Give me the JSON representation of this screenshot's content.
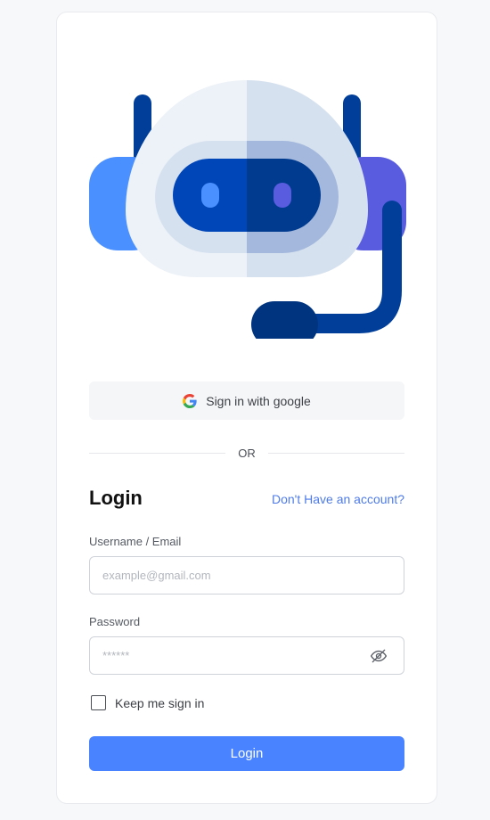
{
  "colors": {
    "accent": "#4a83ff",
    "link": "#4e7be8",
    "page_background": "#f7f8fa",
    "card_background": "#ffffff"
  },
  "illustration": {
    "icon": "robot-headset-icon"
  },
  "google_signin": {
    "icon": "google-icon",
    "label": "Sign in with google"
  },
  "divider": {
    "text": "OR"
  },
  "form": {
    "title": "Login",
    "signup_link": "Don't Have an account?",
    "username": {
      "label": "Username / Email",
      "placeholder": "example@gmail.com",
      "value": ""
    },
    "password": {
      "label": "Password",
      "placeholder": "******",
      "value": "",
      "toggle_icon": "eye-off-icon"
    },
    "remember": {
      "label": "Keep me sign in",
      "checked": false
    },
    "submit_label": "Login"
  }
}
